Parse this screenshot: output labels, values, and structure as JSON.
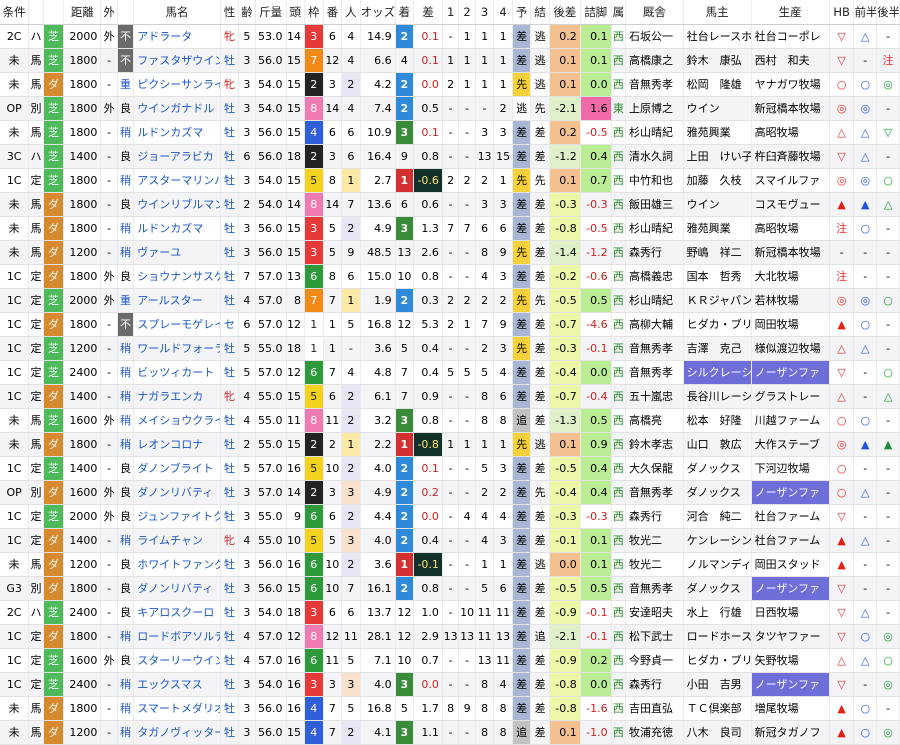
{
  "headers": [
    "条件",
    "",
    "",
    "距離",
    "外",
    "",
    "馬名",
    "性",
    "齢",
    "斤量",
    "頭",
    "枠",
    "番",
    "人",
    "オッズ",
    "着",
    "差",
    "1",
    "2",
    "3",
    "4",
    "予",
    "結",
    "後差",
    "詰脚",
    "属",
    "厩舎",
    "馬主",
    "生産",
    "HB",
    "前半",
    "後半"
  ],
  "rows": [
    {
      "cond": "2C",
      "cls": "ハ",
      "surf": "芝",
      "dist": "2000",
      "out": "外",
      "baba": "不",
      "name": "アドラータ",
      "sex": "牝",
      "age": "5",
      "kin": "53.0",
      "tou": "14",
      "waku": "3",
      "ban": "6",
      "ninki": "4",
      "odds": "14.9",
      "chaku": "2",
      "sa": "0.1",
      "c1": "-",
      "c2": "1",
      "c3": "1",
      "c4": "1",
      "yo": "差",
      "ke": "逃",
      "kosa": "0.2",
      "tsume": "0.1",
      "zoku": "西",
      "kyu": "石坂公一",
      "owner": "社台レースホ",
      "sei": "社台コーポレ",
      "hb": "▽",
      "zen": "△",
      "kou": "-"
    },
    {
      "cond": "未",
      "cls": "馬",
      "surf": "芝",
      "dist": "1800",
      "out": "-",
      "baba": "不",
      "name": "ファスタザウインド",
      "sex": "牡",
      "age": "3",
      "kin": "56.0",
      "tou": "15",
      "waku": "7",
      "ban": "12",
      "ninki": "4",
      "odds": "6.6",
      "chaku": "4",
      "sa": "0.1",
      "c1": "1",
      "c2": "1",
      "c3": "1",
      "c4": "1",
      "yo": "差",
      "ke": "逃",
      "kosa": "0.1",
      "tsume": "0.1",
      "zoku": "西",
      "kyu": "高橋康之",
      "owner": "鈴木　康弘",
      "sei": "西村　和夫",
      "hb": "▽",
      "zen": "-",
      "kou": "注"
    },
    {
      "cond": "未",
      "cls": "馬",
      "surf": "ダ",
      "dist": "1800",
      "out": "-",
      "baba": "重",
      "name": "ピクシーサンライズ",
      "sex": "牝",
      "age": "3",
      "kin": "54.0",
      "tou": "15",
      "waku": "2",
      "ban": "3",
      "ninki": "2",
      "odds": "4.2",
      "chaku": "2",
      "sa": "0.0",
      "c1": "2",
      "c2": "1",
      "c3": "1",
      "c4": "1",
      "yo": "先",
      "ke": "逃",
      "kosa": "0.1",
      "tsume": "0.0",
      "zoku": "西",
      "kyu": "音無秀孝",
      "owner": "松岡　隆雄",
      "sei": "ヤナガワ牧場",
      "hb": "○",
      "zen": "○",
      "kou": "◎"
    },
    {
      "cond": "OP",
      "cls": "別",
      "surf": "芝",
      "dist": "1800",
      "out": "外",
      "baba": "良",
      "name": "ウインガナドル",
      "sex": "牡",
      "age": "3",
      "kin": "54.0",
      "tou": "15",
      "waku": "8",
      "ban": "14",
      "ninki": "4",
      "odds": "7.4",
      "chaku": "2",
      "sa": "0.5",
      "c1": "-",
      "c2": "-",
      "c3": "-",
      "c4": "2",
      "yo": "逃",
      "ke": "先",
      "kosa": "-2.1",
      "tsume": "1.6",
      "zoku": "東",
      "kyu": "上原博之",
      "owner": "ウイン",
      "sei": "新冠橋本牧場",
      "hb": "◎",
      "zen": "◎",
      "kou": "-"
    },
    {
      "cond": "未",
      "cls": "馬",
      "surf": "芝",
      "dist": "1800",
      "out": "-",
      "baba": "稍",
      "name": "ルドンカズマ",
      "sex": "牡",
      "age": "3",
      "kin": "56.0",
      "tou": "15",
      "waku": "4",
      "ban": "6",
      "ninki": "6",
      "odds": "10.9",
      "chaku": "3",
      "sa": "0.1",
      "c1": "-",
      "c2": "-",
      "c3": "3",
      "c4": "3",
      "yo": "差",
      "ke": "差",
      "kosa": "0.2",
      "tsume": "-0.5",
      "zoku": "西",
      "kyu": "杉山晴紀",
      "owner": "雅苑興業",
      "sei": "高昭牧場",
      "hb": "△",
      "zen": "△",
      "kou": "▽"
    },
    {
      "cond": "3C",
      "cls": "ハ",
      "surf": "芝",
      "dist": "1400",
      "out": "-",
      "baba": "良",
      "name": "ジョーアラビカ",
      "sex": "牡",
      "age": "6",
      "kin": "56.0",
      "tou": "18",
      "waku": "2",
      "ban": "3",
      "ninki": "6",
      "odds": "16.4",
      "chaku": "9",
      "sa": "0.8",
      "c1": "-",
      "c2": "-",
      "c3": "13",
      "c4": "15",
      "yo": "差",
      "ke": "差",
      "kosa": "-1.2",
      "tsume": "0.4",
      "zoku": "西",
      "kyu": "清水久詞",
      "owner": "上田　けい子",
      "sei": "杵臼斉藤牧場",
      "hb": "▽",
      "zen": "△",
      "kou": "-"
    },
    {
      "cond": "1C",
      "cls": "定",
      "surf": "芝",
      "dist": "1800",
      "out": "-",
      "baba": "稍",
      "name": "アスターマリンバ",
      "sex": "牡",
      "age": "3",
      "kin": "54.0",
      "tou": "15",
      "waku": "5",
      "ban": "8",
      "ninki": "1",
      "odds": "2.7",
      "chaku": "1",
      "sa": "-0.6",
      "c1": "2",
      "c2": "2",
      "c3": "2",
      "c4": "1",
      "yo": "先",
      "ke": "先",
      "kosa": "0.1",
      "tsume": "0.7",
      "zoku": "西",
      "kyu": "中竹和也",
      "owner": "加藤　久枝",
      "sei": "スマイルファ",
      "hb": "◎",
      "zen": "◎",
      "kou": "○"
    },
    {
      "cond": "未",
      "cls": "馬",
      "surf": "ダ",
      "dist": "1800",
      "out": "-",
      "baba": "良",
      "name": "ウインリブルマン",
      "sex": "牡",
      "age": "2",
      "kin": "54.0",
      "tou": "14",
      "waku": "8",
      "ban": "14",
      "ninki": "7",
      "odds": "13.6",
      "chaku": "6",
      "sa": "0.6",
      "c1": "-",
      "c2": "-",
      "c3": "3",
      "c4": "3",
      "yo": "差",
      "ke": "差",
      "kosa": "-0.3",
      "tsume": "-0.3",
      "zoku": "西",
      "kyu": "飯田雄三",
      "owner": "ウイン",
      "sei": "コスモヴュー",
      "hb": "▲",
      "zen": "▲",
      "kou": "△"
    },
    {
      "cond": "未",
      "cls": "馬",
      "surf": "ダ",
      "dist": "1800",
      "out": "-",
      "baba": "稍",
      "name": "ルドンカズマ",
      "sex": "牡",
      "age": "3",
      "kin": "56.0",
      "tou": "15",
      "waku": "3",
      "ban": "5",
      "ninki": "2",
      "odds": "4.9",
      "chaku": "3",
      "sa": "1.3",
      "c1": "7",
      "c2": "7",
      "c3": "6",
      "c4": "6",
      "yo": "差",
      "ke": "差",
      "kosa": "-0.8",
      "tsume": "-0.5",
      "zoku": "西",
      "kyu": "杉山晴紀",
      "owner": "雅苑興業",
      "sei": "高昭牧場",
      "hb": "注",
      "zen": "○",
      "kou": "-"
    },
    {
      "cond": "未",
      "cls": "馬",
      "surf": "ダ",
      "dist": "1200",
      "out": "-",
      "baba": "稍",
      "name": "ヴァーユ",
      "sex": "牡",
      "age": "3",
      "kin": "56.0",
      "tou": "15",
      "waku": "3",
      "ban": "5",
      "ninki": "9",
      "odds": "48.5",
      "chaku": "13",
      "sa": "2.6",
      "c1": "-",
      "c2": "-",
      "c3": "8",
      "c4": "9",
      "yo": "先",
      "ke": "差",
      "kosa": "-1.4",
      "tsume": "-1.2",
      "zoku": "西",
      "kyu": "森秀行",
      "owner": "野嶋　祥二",
      "sei": "新冠橋本牧場",
      "hb": "-",
      "zen": "-",
      "kou": "-"
    },
    {
      "cond": "1C",
      "cls": "定",
      "surf": "ダ",
      "dist": "1800",
      "out": "外",
      "baba": "良",
      "name": "ショウナンサスケ",
      "sex": "牡",
      "age": "7",
      "kin": "57.0",
      "tou": "13",
      "waku": "6",
      "ban": "8",
      "ninki": "6",
      "odds": "15.0",
      "chaku": "10",
      "sa": "0.8",
      "c1": "-",
      "c2": "-",
      "c3": "4",
      "c4": "3",
      "yo": "差",
      "ke": "差",
      "kosa": "-0.2",
      "tsume": "-0.6",
      "zoku": "西",
      "kyu": "高橋義忠",
      "owner": "国本　哲秀",
      "sei": "大北牧場",
      "hb": "注",
      "zen": "-",
      "kou": "-"
    },
    {
      "cond": "1C",
      "cls": "定",
      "surf": "芝",
      "dist": "2000",
      "out": "外",
      "baba": "重",
      "name": "アールスター",
      "sex": "牡",
      "age": "4",
      "kin": "57.0",
      "tou": "8",
      "waku": "7",
      "ban": "7",
      "ninki": "1",
      "odds": "1.9",
      "chaku": "2",
      "sa": "0.3",
      "c1": "2",
      "c2": "2",
      "c3": "2",
      "c4": "2",
      "yo": "先",
      "ke": "先",
      "kosa": "-0.5",
      "tsume": "0.5",
      "zoku": "西",
      "kyu": "杉山晴紀",
      "owner": "ＫＲジャパン",
      "sei": "若林牧場",
      "hb": "◎",
      "zen": "◎",
      "kou": "○"
    },
    {
      "cond": "1C",
      "cls": "定",
      "surf": "ダ",
      "dist": "1800",
      "out": "-",
      "baba": "不",
      "name": "スプレーモゲレイロ",
      "sex": "セ",
      "age": "6",
      "kin": "57.0",
      "tou": "12",
      "waku": "1",
      "ban": "1",
      "ninki": "5",
      "odds": "16.8",
      "chaku": "12",
      "sa": "5.3",
      "c1": "2",
      "c2": "1",
      "c3": "7",
      "c4": "9",
      "yo": "差",
      "ke": "差",
      "kosa": "-0.7",
      "tsume": "-4.6",
      "zoku": "西",
      "kyu": "高柳大輔",
      "owner": "ヒダカ・ブリ",
      "sei": "岡田牧場",
      "hb": "▲",
      "zen": "○",
      "kou": "-"
    },
    {
      "cond": "1C",
      "cls": "定",
      "surf": "芝",
      "dist": "1200",
      "out": "-",
      "baba": "稍",
      "name": "ワールドフォーラブ",
      "sex": "牡",
      "age": "5",
      "kin": "55.0",
      "tou": "18",
      "waku": "1",
      "ban": "1",
      "ninki": "-",
      "odds": "3.6",
      "chaku": "5",
      "sa": "0.4",
      "c1": "-",
      "c2": "-",
      "c3": "2",
      "c4": "3",
      "yo": "先",
      "ke": "差",
      "kosa": "-0.3",
      "tsume": "-0.1",
      "zoku": "西",
      "kyu": "音無秀孝",
      "owner": "吉澤　克己",
      "sei": "様似渡辺牧場",
      "hb": "△",
      "zen": "△",
      "kou": "-"
    },
    {
      "cond": "1C",
      "cls": "定",
      "surf": "芝",
      "dist": "2400",
      "out": "-",
      "baba": "稍",
      "name": "ビッツィカート",
      "sex": "牡",
      "age": "5",
      "kin": "57.0",
      "tou": "12",
      "waku": "6",
      "ban": "7",
      "ninki": "4",
      "odds": "4.8",
      "chaku": "7",
      "sa": "0.4",
      "c1": "5",
      "c2": "5",
      "c3": "5",
      "c4": "4",
      "yo": "差",
      "ke": "差",
      "kosa": "-0.4",
      "tsume": "0.0",
      "zoku": "西",
      "kyu": "音無秀孝",
      "owner": "シルクレーシ",
      "sei": "ノーザンファ",
      "hb": "▽",
      "zen": "-",
      "kou": "○"
    },
    {
      "cond": "1C",
      "cls": "定",
      "surf": "ダ",
      "dist": "1400",
      "out": "-",
      "baba": "稍",
      "name": "ナガラエンカ",
      "sex": "牝",
      "age": "4",
      "kin": "55.0",
      "tou": "15",
      "waku": "5",
      "ban": "6",
      "ninki": "2",
      "odds": "6.1",
      "chaku": "7",
      "sa": "0.9",
      "c1": "-",
      "c2": "-",
      "c3": "8",
      "c4": "6",
      "yo": "差",
      "ke": "差",
      "kosa": "-0.7",
      "tsume": "-0.4",
      "zoku": "西",
      "kyu": "五十嵐忠",
      "owner": "長谷川レーシ",
      "sei": "グラストレー",
      "hb": "△",
      "zen": "-",
      "kou": "△"
    },
    {
      "cond": "未",
      "cls": "馬",
      "surf": "芝",
      "dist": "1600",
      "out": "外",
      "baba": "稍",
      "name": "メイショウクライム",
      "sex": "牡",
      "age": "4",
      "kin": "55.0",
      "tou": "11",
      "waku": "8",
      "ban": "11",
      "ninki": "2",
      "odds": "3.2",
      "chaku": "3",
      "sa": "0.8",
      "c1": "-",
      "c2": "-",
      "c3": "8",
      "c4": "8",
      "yo": "追",
      "ke": "差",
      "kosa": "-1.3",
      "tsume": "0.5",
      "zoku": "西",
      "kyu": "高橋亮",
      "owner": "松本　好隆",
      "sei": "川越ファーム",
      "hb": "○",
      "zen": "○",
      "kou": "-"
    },
    {
      "cond": "未",
      "cls": "馬",
      "surf": "ダ",
      "dist": "1800",
      "out": "-",
      "baba": "稍",
      "name": "レオンコロナ",
      "sex": "牡",
      "age": "2",
      "kin": "55.0",
      "tou": "15",
      "waku": "2",
      "ban": "2",
      "ninki": "1",
      "odds": "2.2",
      "chaku": "1",
      "sa": "-0.8",
      "c1": "1",
      "c2": "1",
      "c3": "1",
      "c4": "1",
      "yo": "先",
      "ke": "逃",
      "kosa": "0.1",
      "tsume": "0.9",
      "zoku": "西",
      "kyu": "鈴木孝志",
      "owner": "山口　敦広",
      "sei": "大作ステーブ",
      "hb": "◎",
      "zen": "▲",
      "kou": "▲"
    },
    {
      "cond": "1C",
      "cls": "定",
      "surf": "芝",
      "dist": "1400",
      "out": "-",
      "baba": "良",
      "name": "ダノンブライト",
      "sex": "牡",
      "age": "5",
      "kin": "57.0",
      "tou": "16",
      "waku": "5",
      "ban": "10",
      "ninki": "2",
      "odds": "4.0",
      "chaku": "2",
      "sa": "0.1",
      "c1": "-",
      "c2": "-",
      "c3": "5",
      "c4": "3",
      "yo": "差",
      "ke": "差",
      "kosa": "-0.5",
      "tsume": "0.4",
      "zoku": "西",
      "kyu": "大久保龍",
      "owner": "ダノックス",
      "sei": "下河辺牧場",
      "hb": "○",
      "zen": "-",
      "kou": "-"
    },
    {
      "cond": "OP",
      "cls": "別",
      "surf": "ダ",
      "dist": "1600",
      "out": "外",
      "baba": "良",
      "name": "ダノンリバティ",
      "sex": "牡",
      "age": "3",
      "kin": "57.0",
      "tou": "14",
      "waku": "2",
      "ban": "3",
      "ninki": "3",
      "odds": "4.9",
      "chaku": "2",
      "sa": "0.2",
      "c1": "-",
      "c2": "-",
      "c3": "2",
      "c4": "2",
      "yo": "差",
      "ke": "先",
      "kosa": "-0.4",
      "tsume": "0.4",
      "zoku": "西",
      "kyu": "音無秀孝",
      "owner": "ダノックス",
      "sei": "ノーザンファ",
      "hb": "○",
      "zen": "△",
      "kou": "-"
    },
    {
      "cond": "1C",
      "cls": "定",
      "surf": "芝",
      "dist": "2000",
      "out": "外",
      "baba": "良",
      "name": "ジュンファイトクン",
      "sex": "牡",
      "age": "3",
      "kin": "55.0",
      "tou": "9",
      "waku": "6",
      "ban": "6",
      "ninki": "2",
      "odds": "4.4",
      "chaku": "2",
      "sa": "0.0",
      "c1": "-",
      "c2": "4",
      "c3": "4",
      "c4": "4",
      "yo": "差",
      "ke": "差",
      "kosa": "-0.3",
      "tsume": "-0.3",
      "zoku": "西",
      "kyu": "森秀行",
      "owner": "河合　純二",
      "sei": "社台ファーム",
      "hb": "▽",
      "zen": "-",
      "kou": "-"
    },
    {
      "cond": "1C",
      "cls": "定",
      "surf": "ダ",
      "dist": "1400",
      "out": "-",
      "baba": "稍",
      "name": "ライムチャン",
      "sex": "牝",
      "age": "4",
      "kin": "55.0",
      "tou": "10",
      "waku": "5",
      "ban": "5",
      "ninki": "3",
      "odds": "4.0",
      "chaku": "2",
      "sa": "0.4",
      "c1": "-",
      "c2": "-",
      "c3": "4",
      "c4": "3",
      "yo": "差",
      "ke": "差",
      "kosa": "-0.1",
      "tsume": "0.1",
      "zoku": "西",
      "kyu": "牧光二",
      "owner": "ケンレーシン",
      "sei": "社台ファーム",
      "hb": "▲",
      "zen": "△",
      "kou": "-"
    },
    {
      "cond": "未",
      "cls": "馬",
      "surf": "ダ",
      "dist": "1200",
      "out": "-",
      "baba": "良",
      "name": "ホワイトファング",
      "sex": "牡",
      "age": "3",
      "kin": "56.0",
      "tou": "16",
      "waku": "6",
      "ban": "10",
      "ninki": "2",
      "odds": "3.6",
      "chaku": "1",
      "sa": "-0.1",
      "c1": "-",
      "c2": "-",
      "c3": "1",
      "c4": "1",
      "yo": "差",
      "ke": "逃",
      "kosa": "0.0",
      "tsume": "0.1",
      "zoku": "西",
      "kyu": "牧光二",
      "owner": "ノルマンディ",
      "sei": "岡田スタッド",
      "hb": "▲",
      "zen": "-",
      "kou": "-"
    },
    {
      "cond": "G3",
      "cls": "別",
      "surf": "ダ",
      "dist": "1800",
      "out": "-",
      "baba": "良",
      "name": "ダノンリバティ",
      "sex": "牡",
      "age": "3",
      "kin": "56.0",
      "tou": "15",
      "waku": "6",
      "ban": "10",
      "ninki": "7",
      "odds": "16.1",
      "chaku": "2",
      "sa": "0.8",
      "c1": "-",
      "c2": "-",
      "c3": "5",
      "c4": "6",
      "yo": "差",
      "ke": "差",
      "kosa": "-0.5",
      "tsume": "0.5",
      "zoku": "西",
      "kyu": "音無秀孝",
      "owner": "ダノックス",
      "sei": "ノーザンファ",
      "hb": "▽",
      "zen": "-",
      "kou": "-"
    },
    {
      "cond": "2C",
      "cls": "ハ",
      "surf": "芝",
      "dist": "2400",
      "out": "-",
      "baba": "良",
      "name": "キアロスクーロ",
      "sex": "牡",
      "age": "3",
      "kin": "54.0",
      "tou": "18",
      "waku": "3",
      "ban": "6",
      "ninki": "6",
      "odds": "13.7",
      "chaku": "12",
      "sa": "1.0",
      "c1": "-",
      "c2": "10",
      "c3": "11",
      "c4": "11",
      "yo": "差",
      "ke": "差",
      "kosa": "-0.9",
      "tsume": "-0.1",
      "zoku": "西",
      "kyu": "安達昭夫",
      "owner": "水上　行雄",
      "sei": "日西牧場",
      "hb": "▽",
      "zen": "△",
      "kou": "-"
    },
    {
      "cond": "1C",
      "cls": "定",
      "surf": "ダ",
      "dist": "1800",
      "out": "-",
      "baba": "稍",
      "name": "ロードボアソルテ",
      "sex": "牡",
      "age": "4",
      "kin": "57.0",
      "tou": "12",
      "waku": "8",
      "ban": "12",
      "ninki": "11",
      "odds": "28.1",
      "chaku": "12",
      "sa": "2.9",
      "c1": "13",
      "c2": "13",
      "c3": "11",
      "c4": "13",
      "yo": "差",
      "ke": "追",
      "kosa": "-2.1",
      "tsume": "-0.1",
      "zoku": "西",
      "kyu": "松下武士",
      "owner": "ロードホース",
      "sei": "タツヤファー",
      "hb": "▽",
      "zen": "○",
      "kou": "◎"
    },
    {
      "cond": "1C",
      "cls": "定",
      "surf": "芝",
      "dist": "1600",
      "out": "外",
      "baba": "良",
      "name": "スターリーウインド",
      "sex": "牡",
      "age": "4",
      "kin": "57.0",
      "tou": "16",
      "waku": "6",
      "ban": "11",
      "ninki": "5",
      "odds": "7.1",
      "chaku": "10",
      "sa": "0.7",
      "c1": "-",
      "c2": "-",
      "c3": "13",
      "c4": "11",
      "yo": "差",
      "ke": "差",
      "kosa": "-0.9",
      "tsume": "0.2",
      "zoku": "西",
      "kyu": "今野貞一",
      "owner": "ヒダカ・ブリ",
      "sei": "矢野牧場",
      "hb": "△",
      "zen": "△",
      "kou": "○"
    },
    {
      "cond": "1C",
      "cls": "定",
      "surf": "芝",
      "dist": "2400",
      "out": "-",
      "baba": "稍",
      "name": "エックスマス",
      "sex": "牡",
      "age": "3",
      "kin": "54.0",
      "tou": "16",
      "waku": "3",
      "ban": "3",
      "ninki": "3",
      "odds": "4.0",
      "chaku": "3",
      "sa": "0.0",
      "c1": "-",
      "c2": "-",
      "c3": "8",
      "c4": "4",
      "yo": "差",
      "ke": "差",
      "kosa": "-0.8",
      "tsume": "0.0",
      "zoku": "西",
      "kyu": "森秀行",
      "owner": "小田　吉男",
      "sei": "ノーザンファ",
      "hb": "▽",
      "zen": "-",
      "kou": "◎"
    },
    {
      "cond": "未",
      "cls": "馬",
      "surf": "ダ",
      "dist": "1800",
      "out": "-",
      "baba": "稍",
      "name": "スマートメダリオン",
      "sex": "牡",
      "age": "3",
      "kin": "56.0",
      "tou": "16",
      "waku": "4",
      "ban": "7",
      "ninki": "5",
      "odds": "16.8",
      "chaku": "5",
      "sa": "1.7",
      "c1": "8",
      "c2": "9",
      "c3": "8",
      "c4": "8",
      "yo": "差",
      "ke": "差",
      "kosa": "-0.8",
      "tsume": "-1.6",
      "zoku": "西",
      "kyu": "吉田直弘",
      "owner": "ＴＣ倶楽部",
      "sei": "増尾牧場",
      "hb": "▲",
      "zen": "○",
      "kou": "-"
    },
    {
      "cond": "未",
      "cls": "馬",
      "surf": "ダ",
      "dist": "1200",
      "out": "-",
      "baba": "稍",
      "name": "タガノヴィッター",
      "sex": "牡",
      "age": "3",
      "kin": "56.0",
      "tou": "15",
      "waku": "4",
      "ban": "7",
      "ninki": "2",
      "odds": "4.1",
      "chaku": "3",
      "sa": "1.1",
      "c1": "-",
      "c2": "-",
      "c3": "8",
      "c4": "8",
      "yo": "追",
      "ke": "差",
      "kosa": "0.1",
      "tsume": "-1.0",
      "zoku": "西",
      "kyu": "牧浦充徳",
      "owner": "八木　良司",
      "sei": "新冠タガノフ",
      "hb": "▲",
      "zen": "○",
      "kou": "◎"
    }
  ]
}
